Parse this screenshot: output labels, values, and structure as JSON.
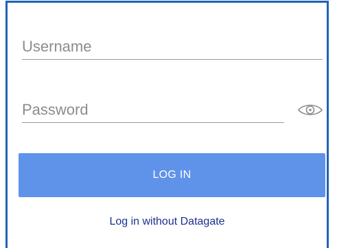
{
  "form": {
    "username": {
      "placeholder": "Username",
      "value": ""
    },
    "password": {
      "placeholder": "Password",
      "value": "",
      "toggle_icon": "eye-icon"
    },
    "login_button_label": "LOG IN",
    "alt_login_link": "Log in without Datagate"
  },
  "colors": {
    "frame_border": "#1e63b4",
    "primary_button": "#5f93ea",
    "link": "#1b2f8f",
    "placeholder": "#8c8c8c"
  }
}
